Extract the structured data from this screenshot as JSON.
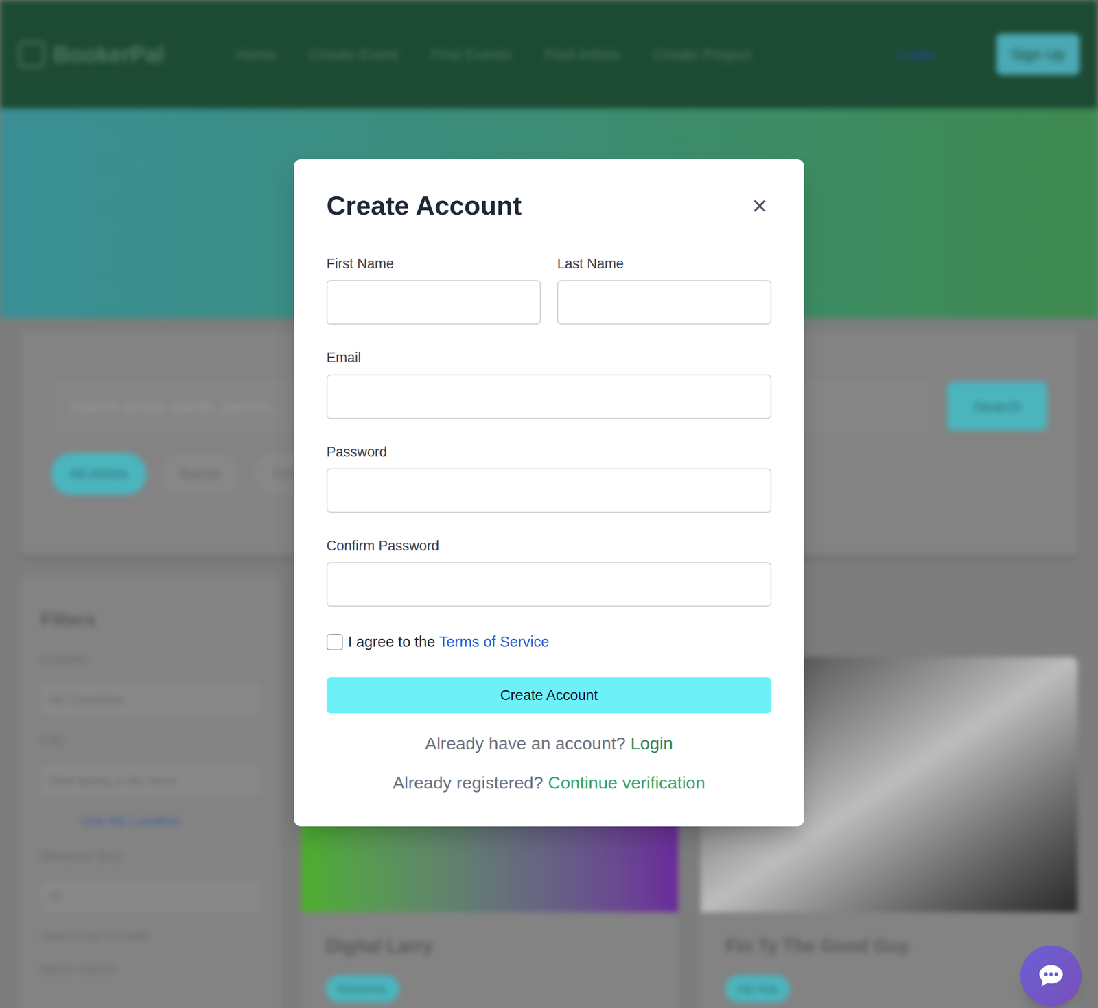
{
  "header": {
    "logo": "BookerPal",
    "nav": [
      "Home",
      "Create Event",
      "Find Events",
      "Find Artists",
      "Create Project"
    ],
    "login": "Login",
    "signup": "Sign Up"
  },
  "search": {
    "placeholder": "Search artists, bands, genres...",
    "button": "Search"
  },
  "chips": [
    {
      "label": "All Artists",
      "selected": true
    },
    {
      "label": "Bands",
      "selected": false
    },
    {
      "label": "Solo",
      "selected": false
    }
  ],
  "filters": {
    "title": "Filters",
    "country_label": "Country",
    "country_value": "All Countries",
    "city_label": "City",
    "city_placeholder": "Start typing a city name",
    "location_link": "Use My Location",
    "distance_label": "Distance (km)",
    "distance_value": "50",
    "distance_hint": "Select a city to enable",
    "genre_label": "Music Genre"
  },
  "artists": [
    {
      "name": "Digital Larry",
      "tag": "Electronic"
    },
    {
      "name": "Fin Ty The Good Guy",
      "tag": "Hip Hop"
    }
  ],
  "modal": {
    "title": "Create Account",
    "close": "×",
    "fields_row": [
      {
        "label": "First Name",
        "value": ""
      },
      {
        "label": "Last Name",
        "value": ""
      }
    ],
    "fields": [
      {
        "label": "Email",
        "value": ""
      },
      {
        "label": "Password",
        "value": ""
      },
      {
        "label": "Confirm Password",
        "value": ""
      }
    ],
    "terms": {
      "text": "I agree to the",
      "link": "Terms of Service",
      "checked": false
    },
    "submit": "Create Account",
    "login_prompt": {
      "text": "Already have an account?",
      "link": "Login"
    },
    "verify_prompt": {
      "text": "Already registered?",
      "link": "Continue verification"
    }
  }
}
